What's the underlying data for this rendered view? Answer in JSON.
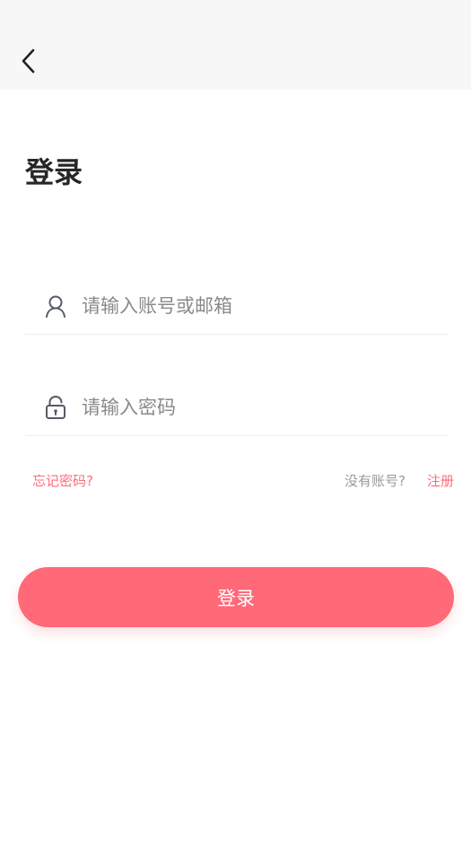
{
  "header": {
    "back_icon": "chevron-left-icon"
  },
  "title": "登录",
  "account_field": {
    "icon": "user-icon",
    "placeholder": "请输入账号或邮箱",
    "value": ""
  },
  "password_field": {
    "icon": "lock-icon",
    "placeholder": "请输入密码",
    "value": ""
  },
  "links": {
    "forgot_password": "忘记密码?",
    "no_account": "没有账号?",
    "register": "注册"
  },
  "login_button": {
    "label": "登录"
  },
  "colors": {
    "accent": "#ff6978",
    "link": "#ff6b7a",
    "header_bg": "#f7f7f7"
  }
}
